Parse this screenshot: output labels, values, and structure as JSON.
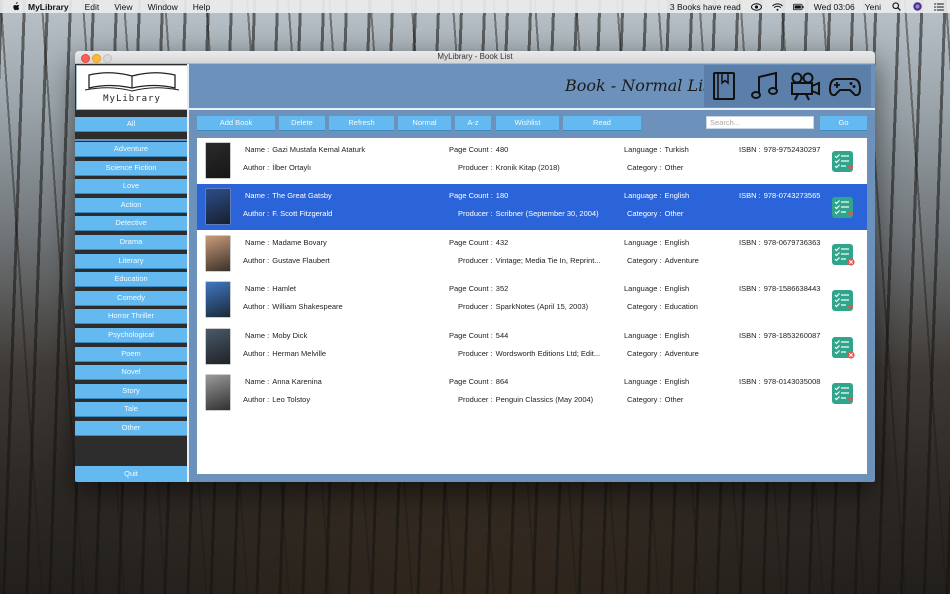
{
  "menubar": {
    "app_name": "MyLibrary",
    "menus": [
      "Edit",
      "View",
      "Window",
      "Help"
    ],
    "status_text": "3 Books have read",
    "clock": "Wed 03:06",
    "user": "Yeni"
  },
  "window": {
    "title": "MyLibrary - Book List"
  },
  "logo": {
    "text": "MyLibrary"
  },
  "header": {
    "title": "Book - Normal List",
    "media_icons": [
      "book-icon",
      "music-note-icon",
      "movie-camera-icon",
      "gamepad-icon"
    ]
  },
  "sidebar": {
    "all_label": "All",
    "categories": [
      "Adventure",
      "Science Fiction",
      "Love",
      "Action",
      "Detective",
      "Drama",
      "Literary",
      "Education",
      "Comedy",
      "Horror Thriller",
      "Psychological",
      "Poem",
      "Novel",
      "Story",
      "Tale",
      "Other"
    ],
    "quit_label": "Quit"
  },
  "toolbar": {
    "buttons": [
      "Add Book",
      "Delete",
      "Refresh",
      "Normal",
      "A-z",
      "Wishlist",
      "Read"
    ],
    "search_placeholder": "Search...",
    "go_label": "Go"
  },
  "labels": {
    "name": "Name :",
    "author": "Author :",
    "page_count": "Page Count :",
    "producer": "Producer :",
    "language": "Language :",
    "category": "Category :",
    "isbn": "ISBN :"
  },
  "books": [
    {
      "name": "Gazi Mustafa Kemal Ataturk",
      "author": "İlber Ortaylı",
      "page_count": "480",
      "producer": "Kronik Kitap (2018)",
      "language": "Turkish",
      "category": "Other",
      "isbn": "978-9752430297",
      "status": "read",
      "cover_color": "#2a2a2a"
    },
    {
      "name": "The Great Gatsby",
      "author": "F. Scott Fitzgerald",
      "page_count": "180",
      "producer": "Scribner (September 30, 2004)",
      "language": "English",
      "category": "Other",
      "isbn": "978-0743273565",
      "status": "read",
      "cover_color": "#2d4e8a"
    },
    {
      "name": "Madame Bovary",
      "author": "Gustave Flaubert",
      "page_count": "432",
      "producer": "Vintage; Media Tie In, Reprint...",
      "language": "English",
      "category": "Adventure",
      "isbn": "978-0679736363",
      "status": "unread",
      "cover_color": "#c99a7a"
    },
    {
      "name": "Hamlet",
      "author": "William Shakespeare",
      "page_count": "352",
      "producer": "SparkNotes (April 15, 2003)",
      "language": "English",
      "category": "Education",
      "isbn": "978-1586638443",
      "status": "read",
      "cover_color": "#3f78c0"
    },
    {
      "name": "Moby Dick",
      "author": "Herman Melville",
      "page_count": "544",
      "producer": "Wordsworth Editions Ltd; Edit...",
      "language": "English",
      "category": "Adventure",
      "isbn": "978-1853260087",
      "status": "unread",
      "cover_color": "#4a5a6a"
    },
    {
      "name": "Anna Karenina",
      "author": "Leo Tolstoy",
      "page_count": "864",
      "producer": "Penguin Classics (May 2004)",
      "language": "English",
      "category": "Other",
      "isbn": "978-0143035008",
      "status": "read",
      "cover_color": "#9a9a9a"
    }
  ],
  "selected_row": 1,
  "colors": {
    "accent": "#64b9f0",
    "window_bg": "#6c92bb",
    "selection": "#2b64d9",
    "sidebar_dark": "#2d2d2d"
  }
}
